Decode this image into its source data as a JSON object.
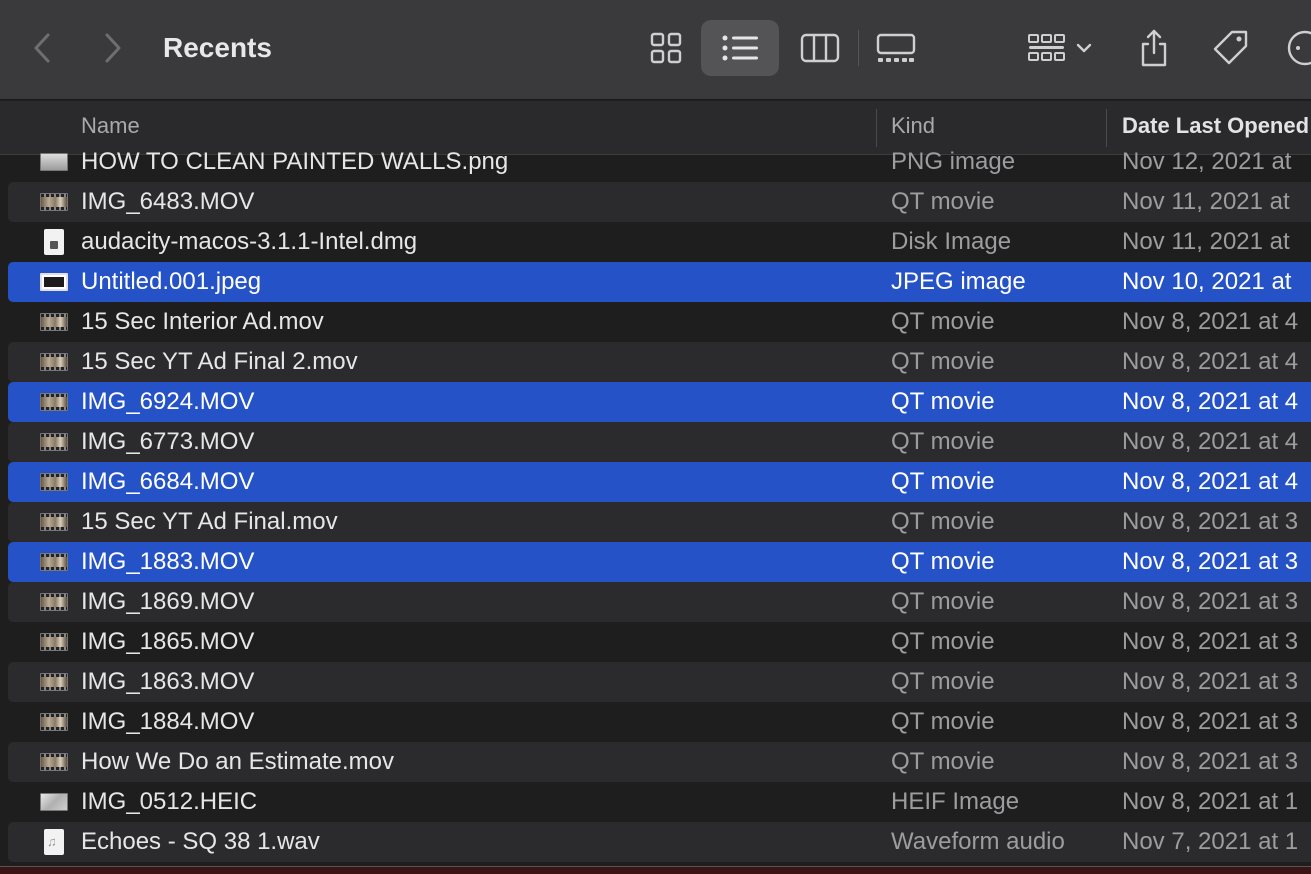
{
  "window": {
    "title": "Recents"
  },
  "toolbar": {
    "back_icon": "chevron-left-icon",
    "forward_icon": "chevron-right-icon",
    "views": [
      "icon-view",
      "list-view",
      "column-view",
      "gallery-view"
    ],
    "selected_view": "list-view",
    "group_icon": "group-by-icon",
    "share_icon": "share-icon",
    "tag_icon": "tag-icon",
    "more_icon": "more-icon"
  },
  "columns": {
    "name": "Name",
    "kind": "Kind",
    "date": "Date Last Opened"
  },
  "colors": {
    "selection": "#2552c6",
    "toolbar": "#3a3a3c",
    "background": "#1e1e1f"
  },
  "files": [
    {
      "name": "HOW TO CLEAN PAINTED WALLS.png",
      "kind": "PNG image",
      "date": "Nov 12, 2021 at",
      "icon": "png",
      "selected": false
    },
    {
      "name": "IMG_6483.MOV",
      "kind": "QT movie",
      "date": "Nov 11, 2021 at",
      "icon": "video",
      "selected": false
    },
    {
      "name": "audacity-macos-3.1.1-Intel.dmg",
      "kind": "Disk Image",
      "date": "Nov 11, 2021 at",
      "icon": "disk",
      "selected": false
    },
    {
      "name": "Untitled.001.jpeg",
      "kind": "JPEG image",
      "date": "Nov 10, 2021 at",
      "icon": "jpeg",
      "selected": true
    },
    {
      "name": "15 Sec Interior Ad.mov",
      "kind": "QT movie",
      "date": "Nov 8, 2021 at 4",
      "icon": "video",
      "selected": false
    },
    {
      "name": "15 Sec YT Ad Final 2.mov",
      "kind": "QT movie",
      "date": "Nov 8, 2021 at 4",
      "icon": "video",
      "selected": false
    },
    {
      "name": "IMG_6924.MOV",
      "kind": "QT movie",
      "date": "Nov 8, 2021 at 4",
      "icon": "video",
      "selected": true
    },
    {
      "name": "IMG_6773.MOV",
      "kind": "QT movie",
      "date": "Nov 8, 2021 at 4",
      "icon": "video",
      "selected": false
    },
    {
      "name": "IMG_6684.MOV",
      "kind": "QT movie",
      "date": "Nov 8, 2021 at 4",
      "icon": "video",
      "selected": true
    },
    {
      "name": "15 Sec YT Ad Final.mov",
      "kind": "QT movie",
      "date": "Nov 8, 2021 at 3",
      "icon": "video",
      "selected": false
    },
    {
      "name": "IMG_1883.MOV",
      "kind": "QT movie",
      "date": "Nov 8, 2021 at 3",
      "icon": "video",
      "selected": true
    },
    {
      "name": "IMG_1869.MOV",
      "kind": "QT movie",
      "date": "Nov 8, 2021 at 3",
      "icon": "video",
      "selected": false
    },
    {
      "name": "IMG_1865.MOV",
      "kind": "QT movie",
      "date": "Nov 8, 2021 at 3",
      "icon": "video",
      "selected": false
    },
    {
      "name": "IMG_1863.MOV",
      "kind": "QT movie",
      "date": "Nov 8, 2021 at 3",
      "icon": "video",
      "selected": false
    },
    {
      "name": "IMG_1884.MOV",
      "kind": "QT movie",
      "date": "Nov 8, 2021 at 3",
      "icon": "video",
      "selected": false
    },
    {
      "name": "How We Do an Estimate.mov",
      "kind": "QT movie",
      "date": "Nov 8, 2021 at 3",
      "icon": "video",
      "selected": false
    },
    {
      "name": "IMG_0512.HEIC",
      "kind": "HEIF Image",
      "date": "Nov 8, 2021 at 1",
      "icon": "heic",
      "selected": false
    },
    {
      "name": "Echoes - SQ 38 1.wav",
      "kind": "Waveform audio",
      "date": "Nov 7, 2021 at 1",
      "icon": "audio",
      "selected": false
    }
  ]
}
